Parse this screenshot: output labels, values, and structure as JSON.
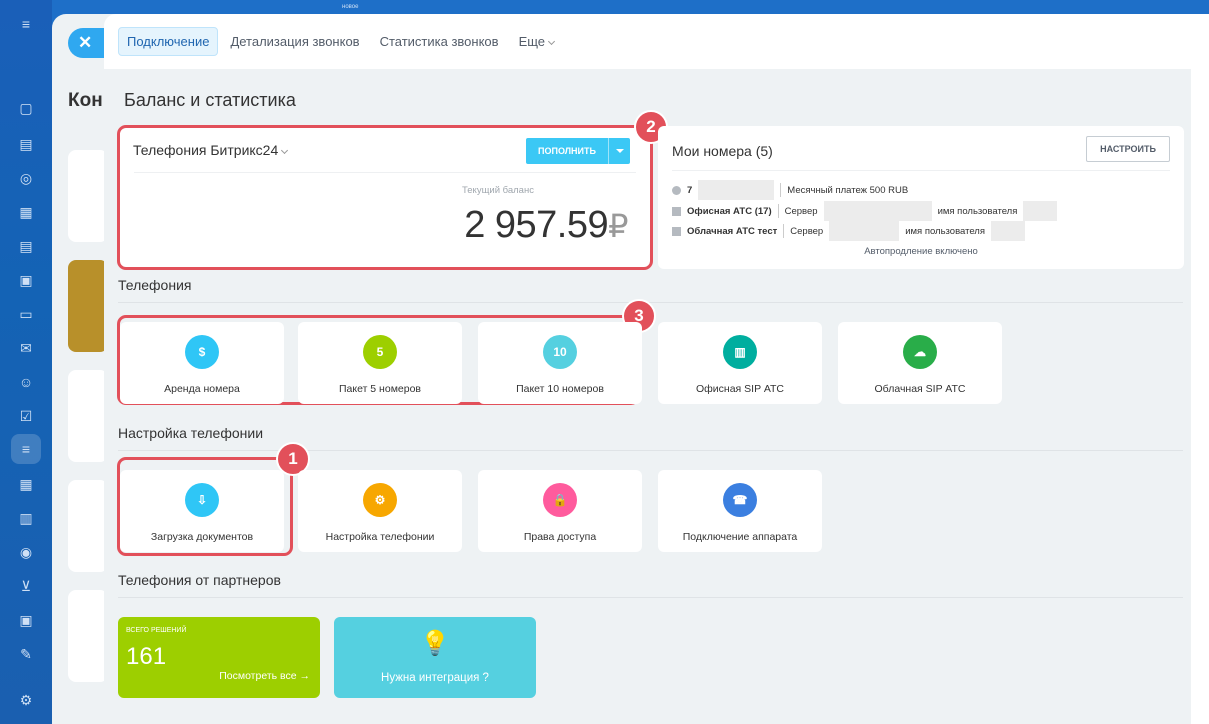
{
  "background": {
    "partial_title": "Кон",
    "top_badge": "новое"
  },
  "tabs": [
    {
      "label": "Подключение"
    },
    {
      "label": "Детализация звонков"
    },
    {
      "label": "Статистика звонков"
    },
    {
      "label": "Еще"
    }
  ],
  "page_title": "Баланс и статистика",
  "balance": {
    "provider": "Телефония Битрикс24",
    "topup_label": "ПОПОЛНИТЬ",
    "current_label": "Текущий баланс",
    "amount": "2 957.59",
    "currency": "₽"
  },
  "numbers": {
    "title": "Мои номера (5)",
    "configure_label": "НАСТРОИТЬ",
    "row1_prefix": "7",
    "row1_info": "Месячный платеж 500 RUB",
    "row2_name": "Офисная АТС (17)",
    "row2_server": "Сервер",
    "row2_user": "имя пользователя",
    "row3_name": "Облачная АТС тест",
    "row3_server": "Сервер",
    "row3_user": "имя пользователя",
    "autorenew": "Автопродление включено"
  },
  "telephony": {
    "title": "Телефония",
    "tiles": [
      {
        "label": "Аренда номера",
        "icon": "phone-rent-icon",
        "color": "#2fc6f6",
        "glyph": "$"
      },
      {
        "label": "Пакет 5 номеров",
        "icon": "package-5-icon",
        "color": "#9dcf00",
        "glyph": "5"
      },
      {
        "label": "Пакет 10 номеров",
        "icon": "package-10-icon",
        "color": "#55d0e0",
        "glyph": "10"
      },
      {
        "label": "Офисная SIP АТС",
        "icon": "office-sip-icon",
        "color": "#00ae9f",
        "glyph": "▥"
      },
      {
        "label": "Облачная SIP АТС",
        "icon": "cloud-sip-icon",
        "color": "#29ad49",
        "glyph": "☁"
      }
    ]
  },
  "settings": {
    "title": "Настройка телефонии",
    "tiles": [
      {
        "label": "Загрузка документов",
        "icon": "document-upload-icon",
        "color": "#2fc6f6",
        "glyph": "⇩"
      },
      {
        "label": "Настройка телефонии",
        "icon": "telephony-settings-icon",
        "color": "#f7a700",
        "glyph": "⚙"
      },
      {
        "label": "Права доступа",
        "icon": "access-rights-icon",
        "color": "#ff5b9d",
        "glyph": "🔒"
      },
      {
        "label": "Подключение аппарата",
        "icon": "device-connect-icon",
        "color": "#3b7fe0",
        "glyph": "☎"
      }
    ]
  },
  "partners": {
    "title": "Телефония от партнеров",
    "total_label": "ВСЕГО РЕШЕНИЙ",
    "total_value": "161",
    "view_all": "Посмотреть все",
    "integration_label": "Нужна интеграция ?"
  },
  "markers": {
    "one": "1",
    "two": "2",
    "three": "3"
  },
  "colors": {
    "accent": "#3bc8f5",
    "highlight": "#e2505a",
    "partners_green": "#9dcf00",
    "partners_cyan": "#55d0e0"
  }
}
